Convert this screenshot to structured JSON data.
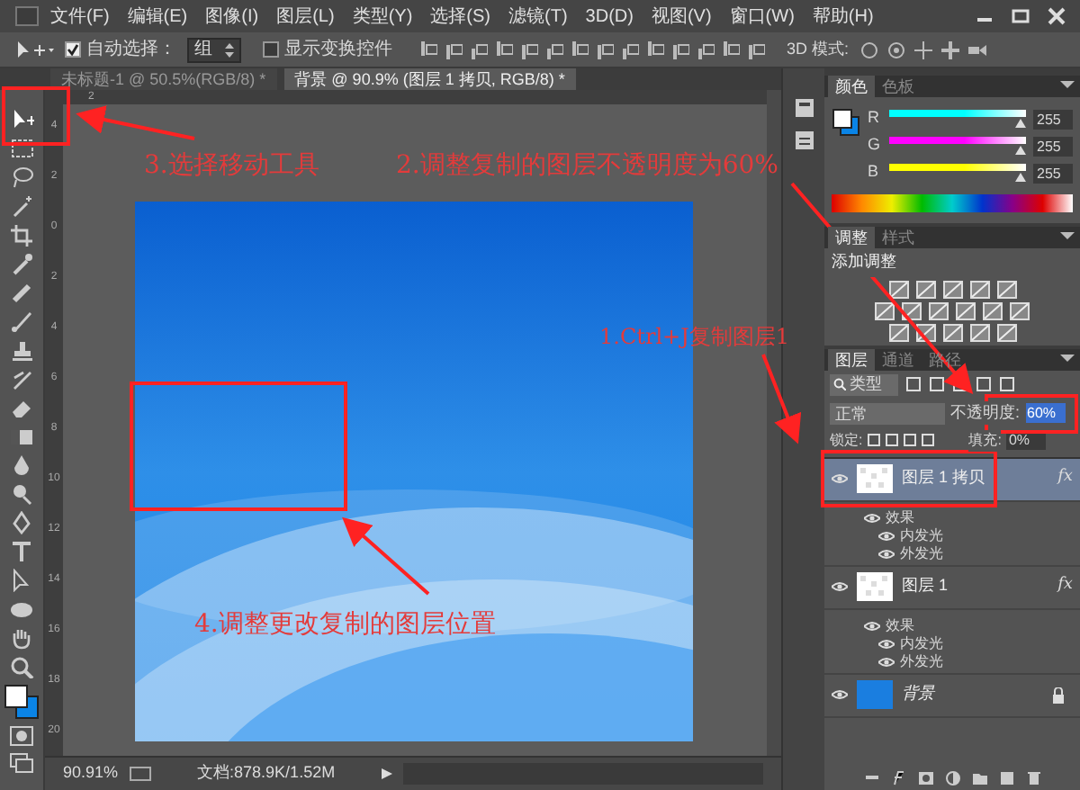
{
  "menu": [
    "文件(F)",
    "编辑(E)",
    "图像(I)",
    "图层(L)",
    "类型(Y)",
    "选择(S)",
    "滤镜(T)",
    "3D(D)",
    "视图(V)",
    "窗口(W)",
    "帮助(H)"
  ],
  "options_bar": {
    "auto_select": {
      "label": "自动选择：",
      "checked": true
    },
    "auto_select_target": "组",
    "transform_controls": {
      "label": "显示变换控件",
      "checked": false
    },
    "mode_3d_label": "3D 模式:"
  },
  "tabs": [
    {
      "label": "未标题-1 @ 50.5%(RGB/8) *",
      "selected": false
    },
    {
      "label": "背景 @ 90.9% (图层 1 拷贝, RGB/8) *",
      "selected": true
    }
  ],
  "ruler": {
    "horizontal": [
      "2"
    ],
    "vertical": [
      "4",
      "2",
      "0",
      "2",
      "4",
      "6",
      "8",
      "10",
      "12",
      "14",
      "16",
      "18",
      "20"
    ]
  },
  "status_bar": {
    "zoom": "90.91%",
    "document": "文档:878.9K/1.52M"
  },
  "color_panel": {
    "tabs": [
      {
        "label": "颜色",
        "selected": true
      },
      {
        "label": "色板",
        "selected": false
      }
    ],
    "channels": [
      {
        "name": "R",
        "value": "255",
        "level": 1,
        "color": "#00ffff"
      },
      {
        "name": "G",
        "value": "255",
        "level": 1,
        "color": "#ff00ff"
      },
      {
        "name": "B",
        "value": "255",
        "level": 1,
        "color": "#ffff00"
      }
    ]
  },
  "adjustments_panel": {
    "tabs": [
      {
        "label": "调整",
        "selected": true
      },
      {
        "label": "样式",
        "selected": false
      }
    ],
    "title": "添加调整"
  },
  "layers_panel": {
    "tabs": [
      {
        "label": "图层",
        "selected": true
      },
      {
        "label": "通道",
        "selected": false
      },
      {
        "label": "路径",
        "selected": false
      }
    ],
    "filter": "类型",
    "blend_mode": "正常",
    "opacity_label": "不透明度:",
    "opacity": "60%",
    "lock_label": "锁定:",
    "fill_label": "填充:",
    "fill": "0%",
    "layers": [
      {
        "name": "图层 1 拷贝",
        "kind": "transparent",
        "selected": true,
        "visible": true,
        "locked": false,
        "effects": {
          "badge": "fx",
          "label": "效果",
          "children": [
            "内发光",
            "外发光"
          ]
        }
      },
      {
        "name": "图层 1",
        "kind": "transparent",
        "selected": false,
        "visible": true,
        "locked": false,
        "effects": {
          "badge": "fx",
          "label": "效果",
          "children": [
            "内发光",
            "外发光"
          ]
        }
      },
      {
        "name": "背景",
        "kind": "fill",
        "selected": false,
        "visible": true,
        "locked": true
      }
    ]
  },
  "annotations": [
    {
      "text": "3.选择移动工具"
    },
    {
      "text": "2.调整复制的图层不透明度为60%"
    },
    {
      "text": "1.Ctrl+J复制图层1"
    },
    {
      "text": "4.调整更改复制的图层位置"
    }
  ]
}
